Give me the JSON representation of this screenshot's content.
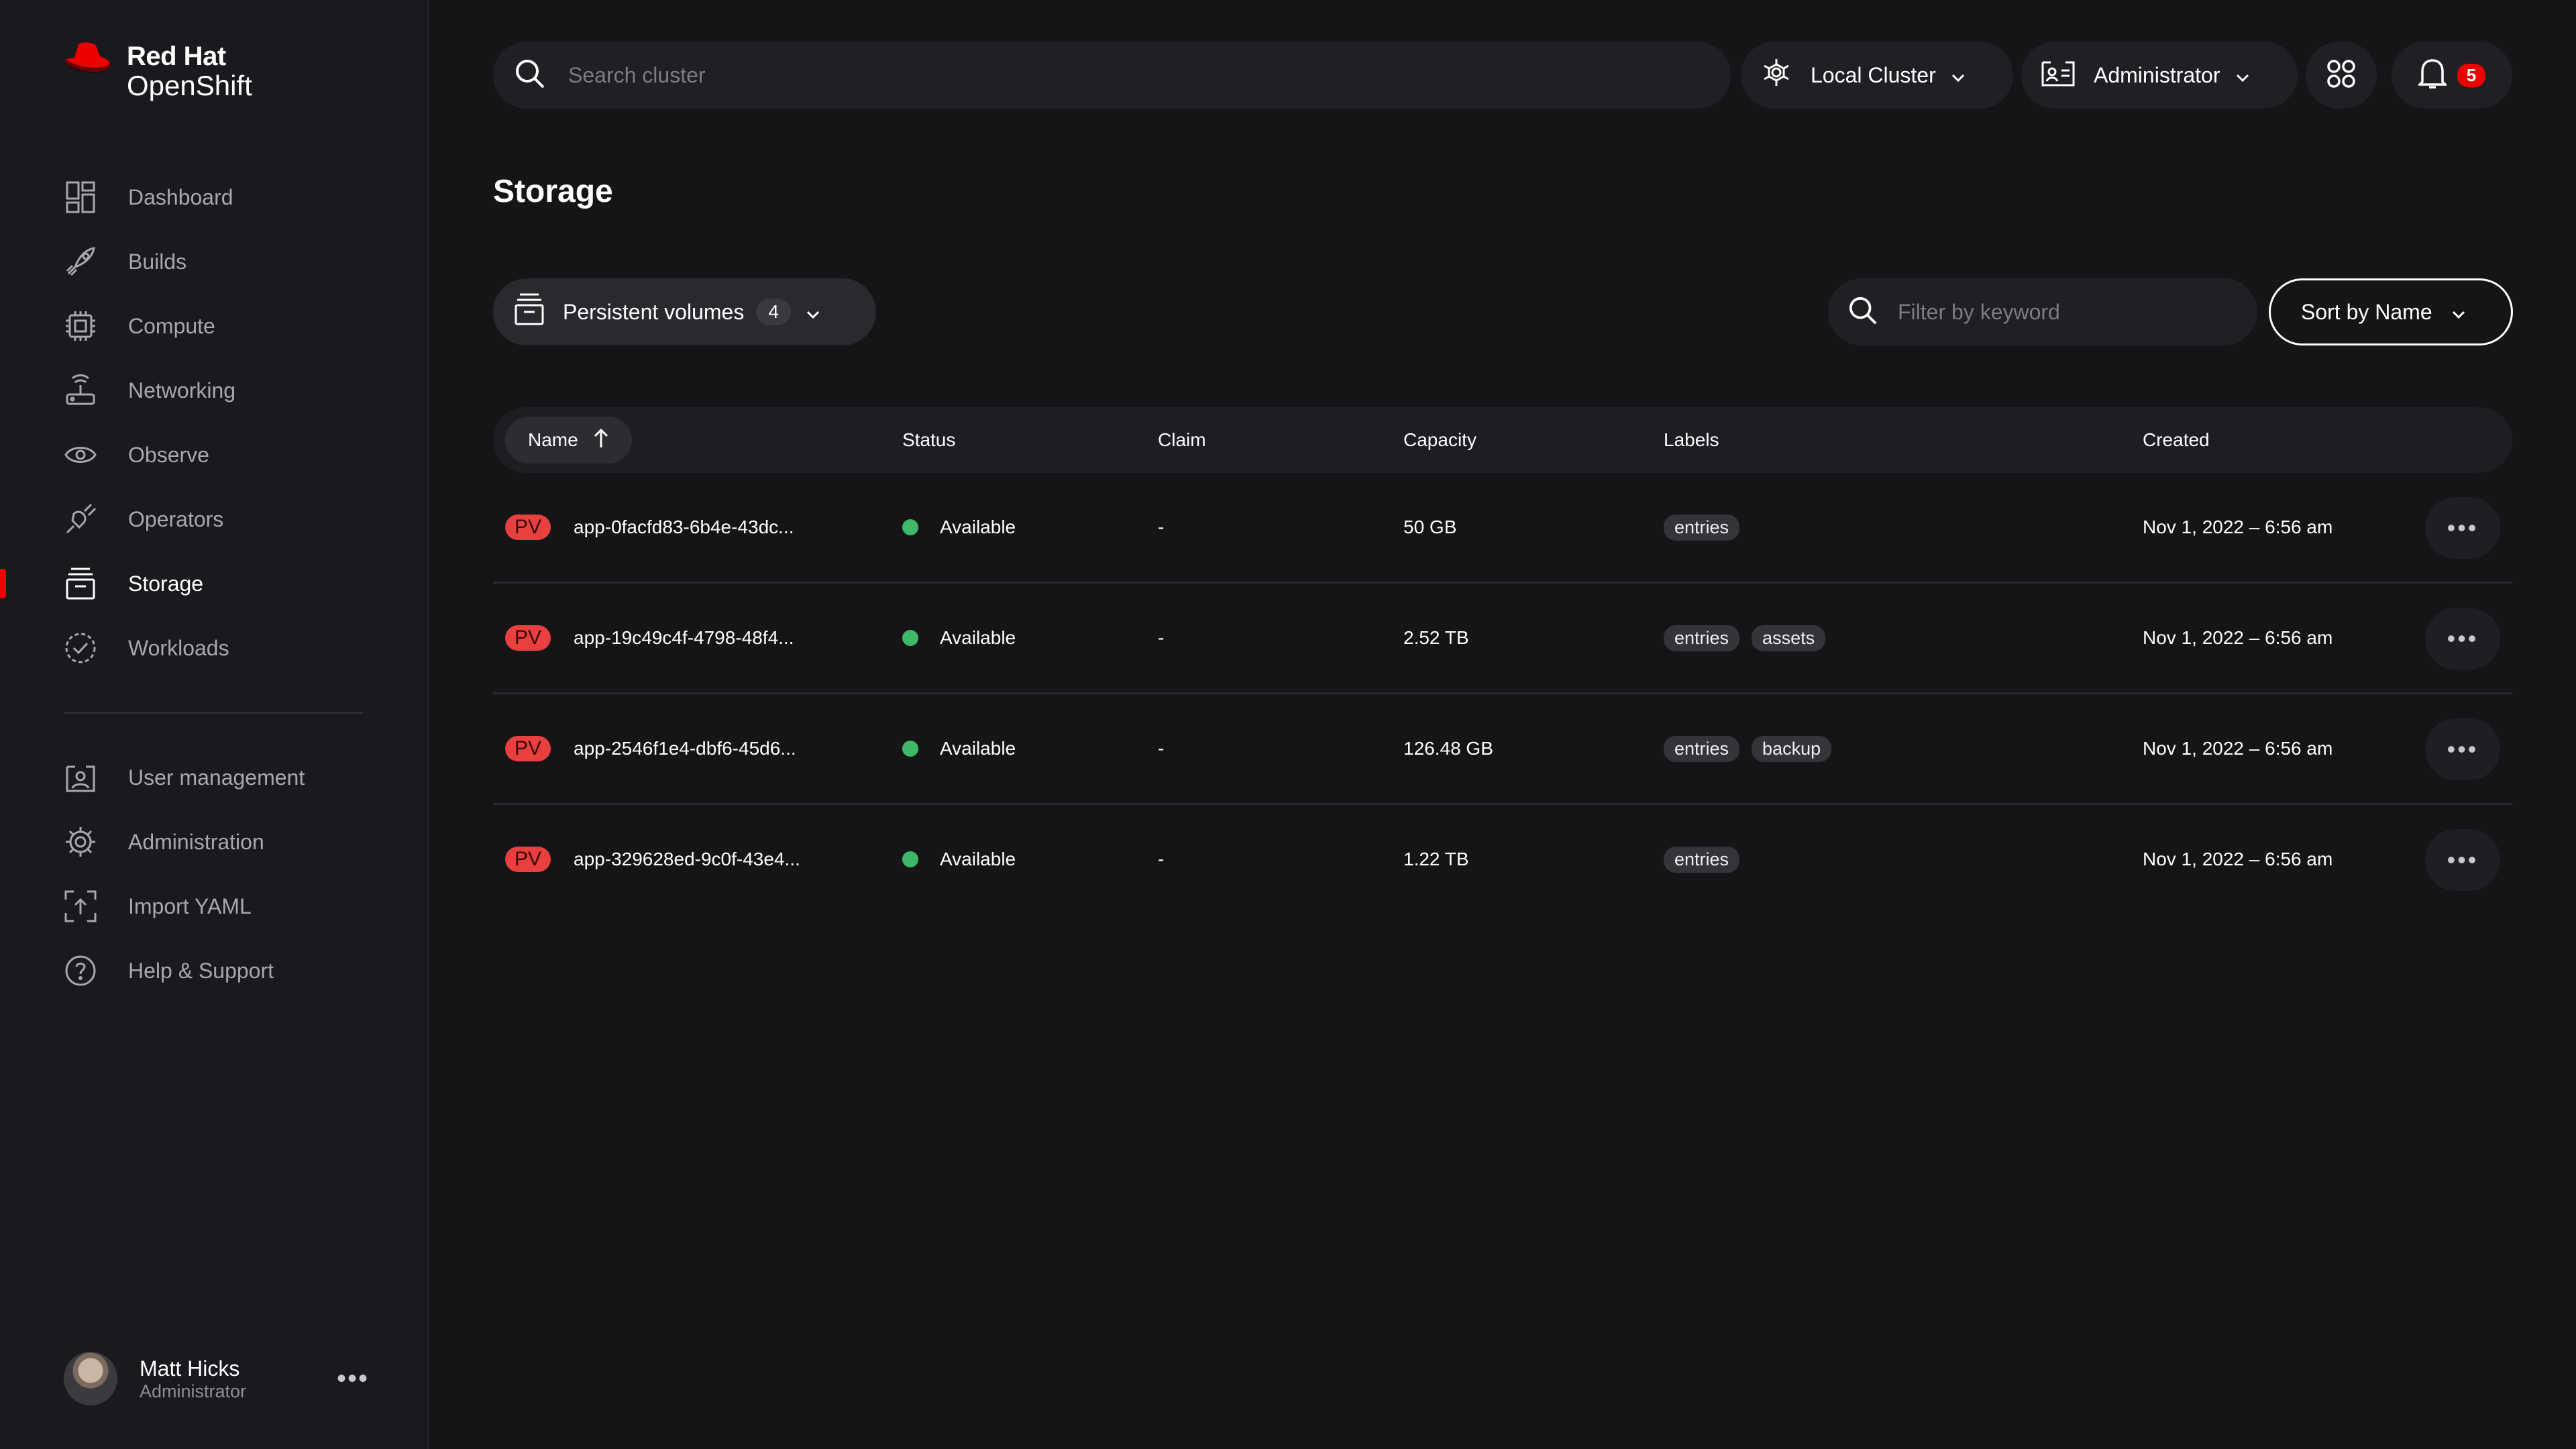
{
  "brand": {
    "line1": "Red Hat",
    "line2": "OpenShift"
  },
  "nav": {
    "items": [
      {
        "label": "Dashboard",
        "icon": "dashboard-icon"
      },
      {
        "label": "Builds",
        "icon": "builds-icon"
      },
      {
        "label": "Compute",
        "icon": "chip-icon"
      },
      {
        "label": "Networking",
        "icon": "router-icon"
      },
      {
        "label": "Observe",
        "icon": "eye-icon"
      },
      {
        "label": "Operators",
        "icon": "plug-icon"
      },
      {
        "label": "Storage",
        "icon": "storage-icon",
        "active": true
      },
      {
        "label": "Workloads",
        "icon": "check-circle-icon"
      }
    ],
    "secondary": [
      {
        "label": "User management",
        "icon": "user-icon"
      },
      {
        "label": "Administration",
        "icon": "gear-icon"
      },
      {
        "label": "Import YAML",
        "icon": "upload-icon"
      },
      {
        "label": "Help & Support",
        "icon": "help-icon"
      }
    ]
  },
  "user": {
    "name": "Matt Hicks",
    "role": "Administrator"
  },
  "topbar": {
    "search_placeholder": "Search cluster",
    "cluster": "Local Cluster",
    "role": "Administrator",
    "notifications": "5"
  },
  "page": {
    "title": "Storage",
    "selector_label": "Persistent volumes",
    "selector_count": "4",
    "filter_placeholder": "Filter by keyword",
    "sort_label": "Sort by Name"
  },
  "table": {
    "columns": {
      "name": "Name",
      "status": "Status",
      "claim": "Claim",
      "capacity": "Capacity",
      "labels": "Labels",
      "created": "Created"
    },
    "rows": [
      {
        "type": "PV",
        "name": "app-0facfd83-6b4e-43dc...",
        "status": "Available",
        "claim": "-",
        "capacity": "50 GB",
        "label1": "entries",
        "label2": "",
        "created": "Nov 1, 2022 – 6:56 am"
      },
      {
        "type": "PV",
        "name": "app-19c49c4f-4798-48f4...",
        "status": "Available",
        "claim": "-",
        "capacity": "2.52 TB",
        "label1": "entries",
        "label2": "assets",
        "created": "Nov 1, 2022 – 6:56 am"
      },
      {
        "type": "PV",
        "name": "app-2546f1e4-dbf6-45d6...",
        "status": "Available",
        "claim": "-",
        "capacity": "126.48 GB",
        "label1": "entries",
        "label2": "backup",
        "created": "Nov 1, 2022 – 6:56 am"
      },
      {
        "type": "PV",
        "name": "app-329628ed-9c0f-43e4...",
        "status": "Available",
        "claim": "-",
        "capacity": "1.22 TB",
        "label1": "entries",
        "label2": "",
        "created": "Nov 1, 2022 – 6:56 am"
      }
    ]
  },
  "colors": {
    "accent": "#ee0000",
    "available": "#3fb869",
    "background": "#151417"
  }
}
